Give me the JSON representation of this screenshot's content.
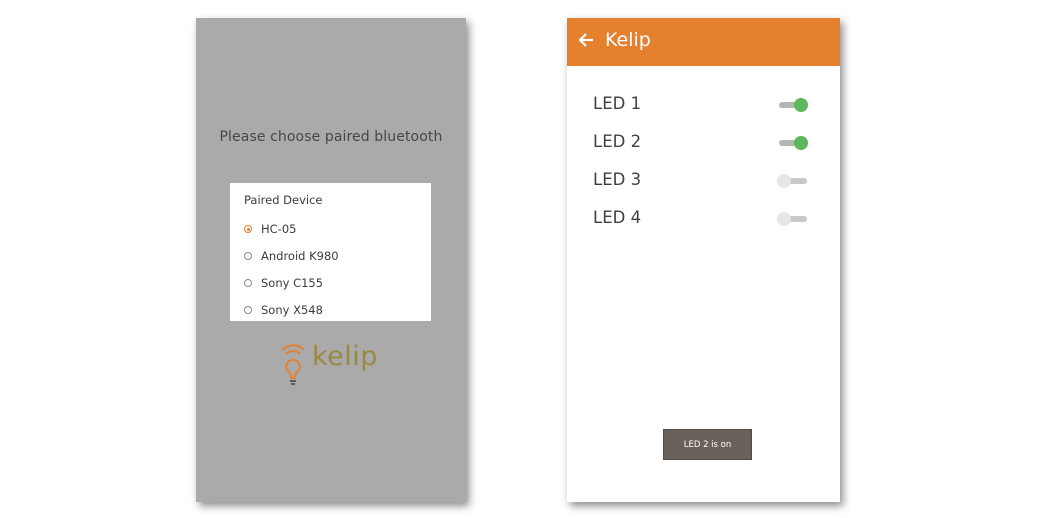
{
  "left_screen": {
    "prompt": "Please choose paired bluetooth",
    "dialog": {
      "title": "Paired Device",
      "devices": [
        {
          "label": "HC-05",
          "selected": true
        },
        {
          "label": "Android K980",
          "selected": false
        },
        {
          "label": "Sony C155",
          "selected": false
        },
        {
          "label": "Sony X548",
          "selected": false
        }
      ]
    },
    "logo": {
      "text": "kelip",
      "icon": "lightbulb-signal-icon",
      "color": "#9a8a3f"
    }
  },
  "right_screen": {
    "appbar": {
      "title": "Kelip",
      "back_icon": "arrow-left-icon",
      "color": "#e5802e"
    },
    "leds": [
      {
        "label": "LED 1",
        "on": true
      },
      {
        "label": "LED 2",
        "on": true
      },
      {
        "label": "LED 3",
        "on": false
      },
      {
        "label": "LED 4",
        "on": false
      }
    ],
    "toast": "LED 2 is on"
  }
}
